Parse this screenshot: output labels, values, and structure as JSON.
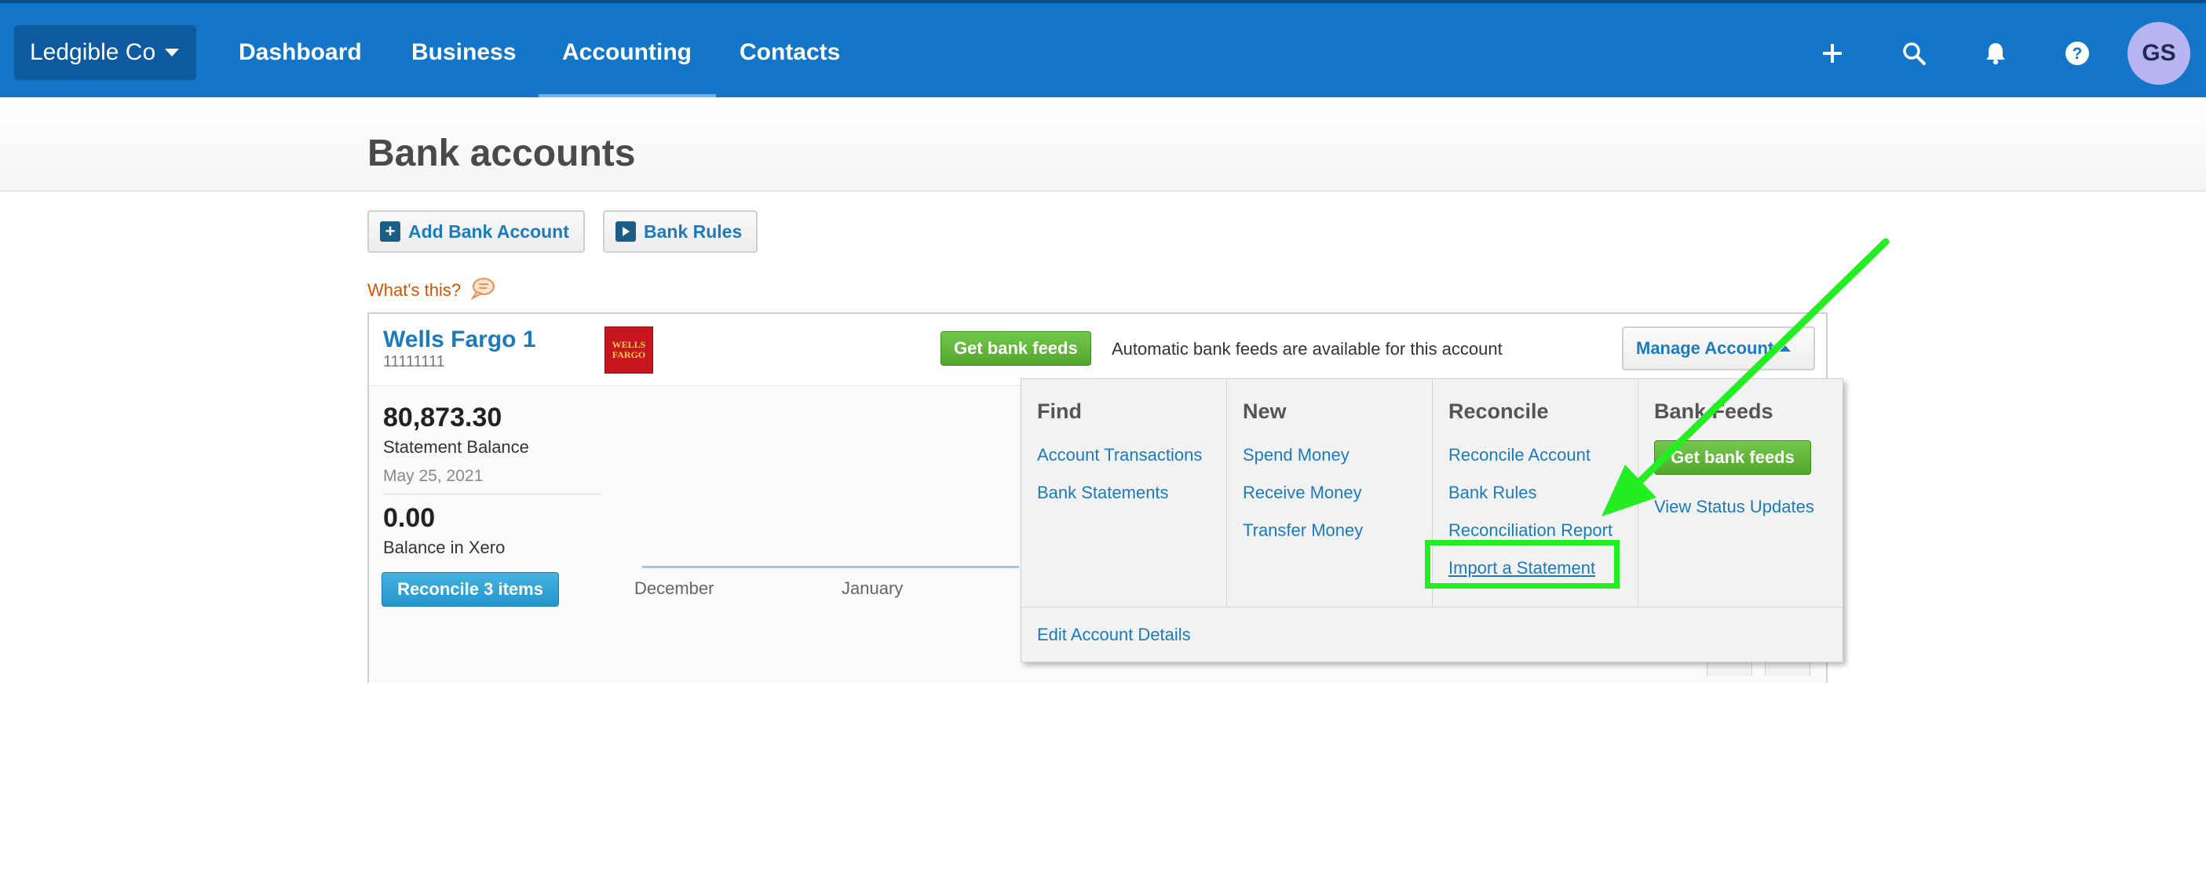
{
  "topnav": {
    "org_name": "Ledgible Co",
    "links": [
      "Dashboard",
      "Business",
      "Accounting",
      "Contacts"
    ],
    "active": "Accounting",
    "avatar_initials": "GS",
    "icons": [
      "plus-icon",
      "search-icon",
      "bell-icon",
      "help-icon"
    ]
  },
  "page": {
    "title": "Bank accounts",
    "add_bank_account": "Add Bank Account",
    "bank_rules": "Bank Rules",
    "whats_this": "What's this?"
  },
  "account": {
    "name": "Wells Fargo 1",
    "number": "11111111",
    "logo_text": "WELLS FARGO",
    "get_feeds_label": "Get bank feeds",
    "feeds_note": "Automatic bank feeds are available for this account",
    "manage_label": "Manage Account",
    "statement_balance": "80,873.30",
    "statement_balance_label": "Statement Balance",
    "statement_date": "May 25, 2021",
    "xero_balance": "0.00",
    "xero_balance_label": "Balance in Xero",
    "reconcile_label": "Reconcile 3 items",
    "months": [
      "December",
      "January"
    ]
  },
  "menu": {
    "find": {
      "title": "Find",
      "items": [
        "Account Transactions",
        "Bank Statements"
      ]
    },
    "new": {
      "title": "New",
      "items": [
        "Spend Money",
        "Receive Money",
        "Transfer Money"
      ]
    },
    "reconcile": {
      "title": "Reconcile",
      "items": [
        "Reconcile Account",
        "Bank Rules",
        "Reconciliation Report",
        "Import a Statement"
      ]
    },
    "bank_feeds": {
      "title": "Bank Feeds",
      "button": "Get bank feeds",
      "items": [
        "View Status Updates"
      ]
    },
    "edit_details": "Edit Account Details"
  },
  "annotation": {
    "highlight_color": "#22ee22",
    "target": "Import a Statement"
  },
  "colors": {
    "nav_bg": "#1476c8",
    "link": "#1b7bbd",
    "green": "#52a62c",
    "accent_orange": "#d35400"
  }
}
